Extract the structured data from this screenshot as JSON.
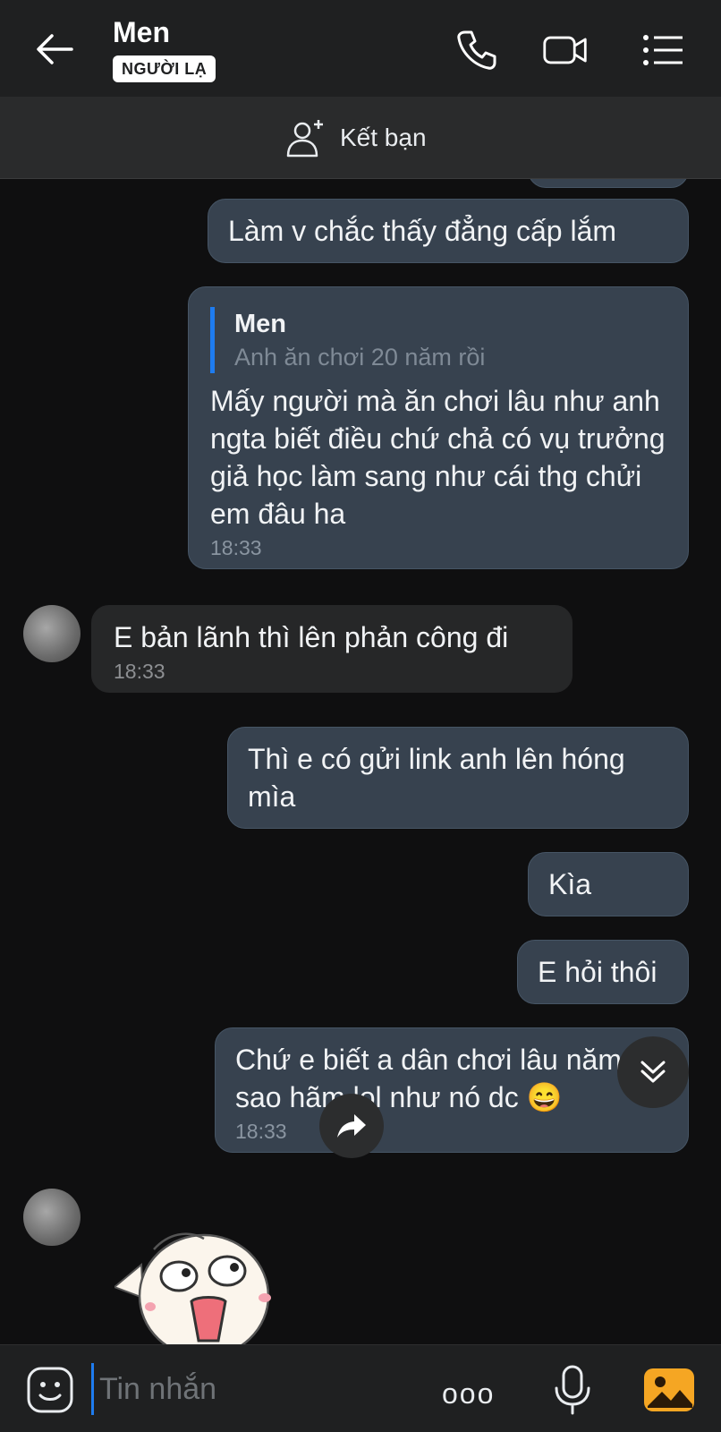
{
  "header": {
    "title": "Men",
    "badge": "NGƯỜI LẠ",
    "icons": [
      "back-arrow-icon",
      "phone-icon",
      "video-call-icon",
      "menu-icon"
    ]
  },
  "add_friend": {
    "label": "Kết bạn",
    "icon": "add-person-icon"
  },
  "messages": [
    {
      "id": "m1",
      "side": "out",
      "text": "Làm v chắc thấy đẳng cấp lắm"
    },
    {
      "id": "m2",
      "side": "out",
      "quote_name": "Men",
      "quote_text": "Anh ăn chơi 20 năm rồi",
      "text": "Mấy người mà ăn chơi lâu như anh ngta biết điều chứ chả có vụ trưởng giả học làm sang như cái thg chửi em đâu ha",
      "time": "18:33"
    },
    {
      "id": "m3",
      "side": "in",
      "text": "E bản lãnh thì lên phản công đi",
      "time": "18:33"
    },
    {
      "id": "m4",
      "side": "out",
      "text": "Thì e có gửi link anh lên hóng mìa"
    },
    {
      "id": "m5",
      "side": "out",
      "text": "Kìa"
    },
    {
      "id": "m6",
      "side": "out",
      "text": "E hỏi thôi"
    },
    {
      "id": "m7",
      "side": "out",
      "text": "Chứ e biết a dân chơi lâu năm, sao hãm lol như nó dc 😄",
      "time": "18:33"
    }
  ],
  "composer": {
    "placeholder": "Tin nhắn",
    "more_label": "ooo",
    "icons": [
      "emoji-sticker-icon",
      "more-options-icon",
      "microphone-icon",
      "gallery-icon"
    ]
  },
  "colors": {
    "background": "#0f0f10",
    "outgoing_bubble": "#37424f",
    "incoming_bubble": "#262728",
    "accent": "#1e7cf0",
    "gallery": "#f5a623"
  }
}
